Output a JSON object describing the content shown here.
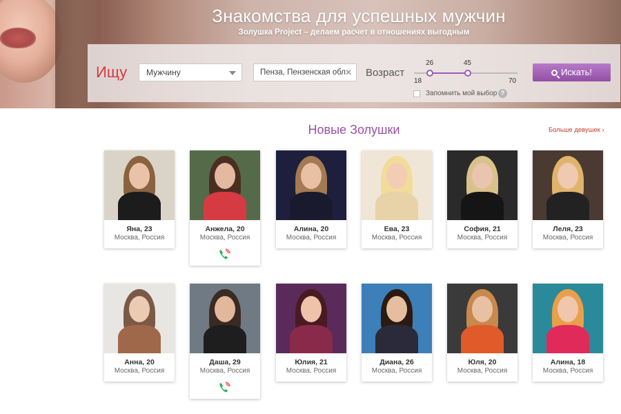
{
  "hero": {
    "title": "Знакомства для успешных мужчин",
    "subtitle": "Золушка Project – делаем расчет в отношениях выгодным"
  },
  "search": {
    "label": "Ищу",
    "gender_value": "Мужчину",
    "city_value": "Пенза, Пензенская обл",
    "age_label": "Возраст",
    "age_min": 18,
    "age_max": 70,
    "age_from": "26",
    "age_to": "45",
    "range_min_label": "18",
    "range_max_label": "70",
    "remember_label": "Запомнить мой выбор",
    "help_label": "?",
    "button_label": "Искать!",
    "accent_color": "#9b59b6"
  },
  "section": {
    "title": "Новые Золушки",
    "more_link": "Больше девушек ›"
  },
  "profiles": [
    {
      "name": "Яна, 23",
      "location": "Москва, Россия",
      "phone": false,
      "bg": "#d9d4c7",
      "skin": "#e9c2a8",
      "hair": "#8a6240",
      "top": "#1c1c1c"
    },
    {
      "name": "Анжела, 20",
      "location": "Москва, Россия",
      "phone": true,
      "bg": "#556a49",
      "skin": "#e5b99f",
      "hair": "#4a2e22",
      "top": "#d63a43"
    },
    {
      "name": "Алина, 20",
      "location": "Москва, Россия",
      "phone": false,
      "bg": "#1d1f3d",
      "skin": "#e8c0a6",
      "hair": "#a37a52",
      "top": "#1a1a2e"
    },
    {
      "name": "Ева, 23",
      "location": "Москва, Россия",
      "phone": false,
      "bg": "#f0e6d8",
      "skin": "#f2cdb3",
      "hair": "#f1dc9a",
      "top": "#e8d3a8"
    },
    {
      "name": "София, 21",
      "location": "Москва, Россия",
      "phone": false,
      "bg": "#2a2a2a",
      "skin": "#e9c4ae",
      "hair": "#d9c28a",
      "top": "#151515"
    },
    {
      "name": "Леля, 23",
      "location": "Москва, Россия",
      "phone": false,
      "bg": "#4a3a32",
      "skin": "#efc9b1",
      "hair": "#e0b46a",
      "top": "#222222"
    },
    {
      "name": "Анна, 20",
      "location": "Москва, Россия",
      "phone": false,
      "bg": "#e8e6e2",
      "skin": "#edcab2",
      "hair": "#7a5a46",
      "top": "#a0684a"
    },
    {
      "name": "Даша, 29",
      "location": "Москва, Россия",
      "phone": true,
      "bg": "#6f7a84",
      "skin": "#e2b79c",
      "hair": "#3a2a22",
      "top": "#1e1e1e"
    },
    {
      "name": "Юлия, 21",
      "location": "Москва, Россия",
      "phone": false,
      "bg": "#5a2a5a",
      "skin": "#efc3aa",
      "hair": "#4a1a22",
      "top": "#8a2a4a"
    },
    {
      "name": "Диана, 26",
      "location": "Москва, Россия",
      "phone": false,
      "bg": "#3d7fb8",
      "skin": "#e6bd9f",
      "hair": "#2a1a12",
      "top": "#2a2a3a"
    },
    {
      "name": "Юля, 20",
      "location": "Москва, Россия",
      "phone": false,
      "bg": "#3a3a3a",
      "skin": "#e8c0a4",
      "hair": "#c88a4a",
      "top": "#e05a2a"
    },
    {
      "name": "Алина, 18",
      "location": "Москва, Россия",
      "phone": false,
      "bg": "#2a8a9a",
      "skin": "#f0c6ad",
      "hair": "#e8a04a",
      "top": "#e02a5a"
    }
  ]
}
